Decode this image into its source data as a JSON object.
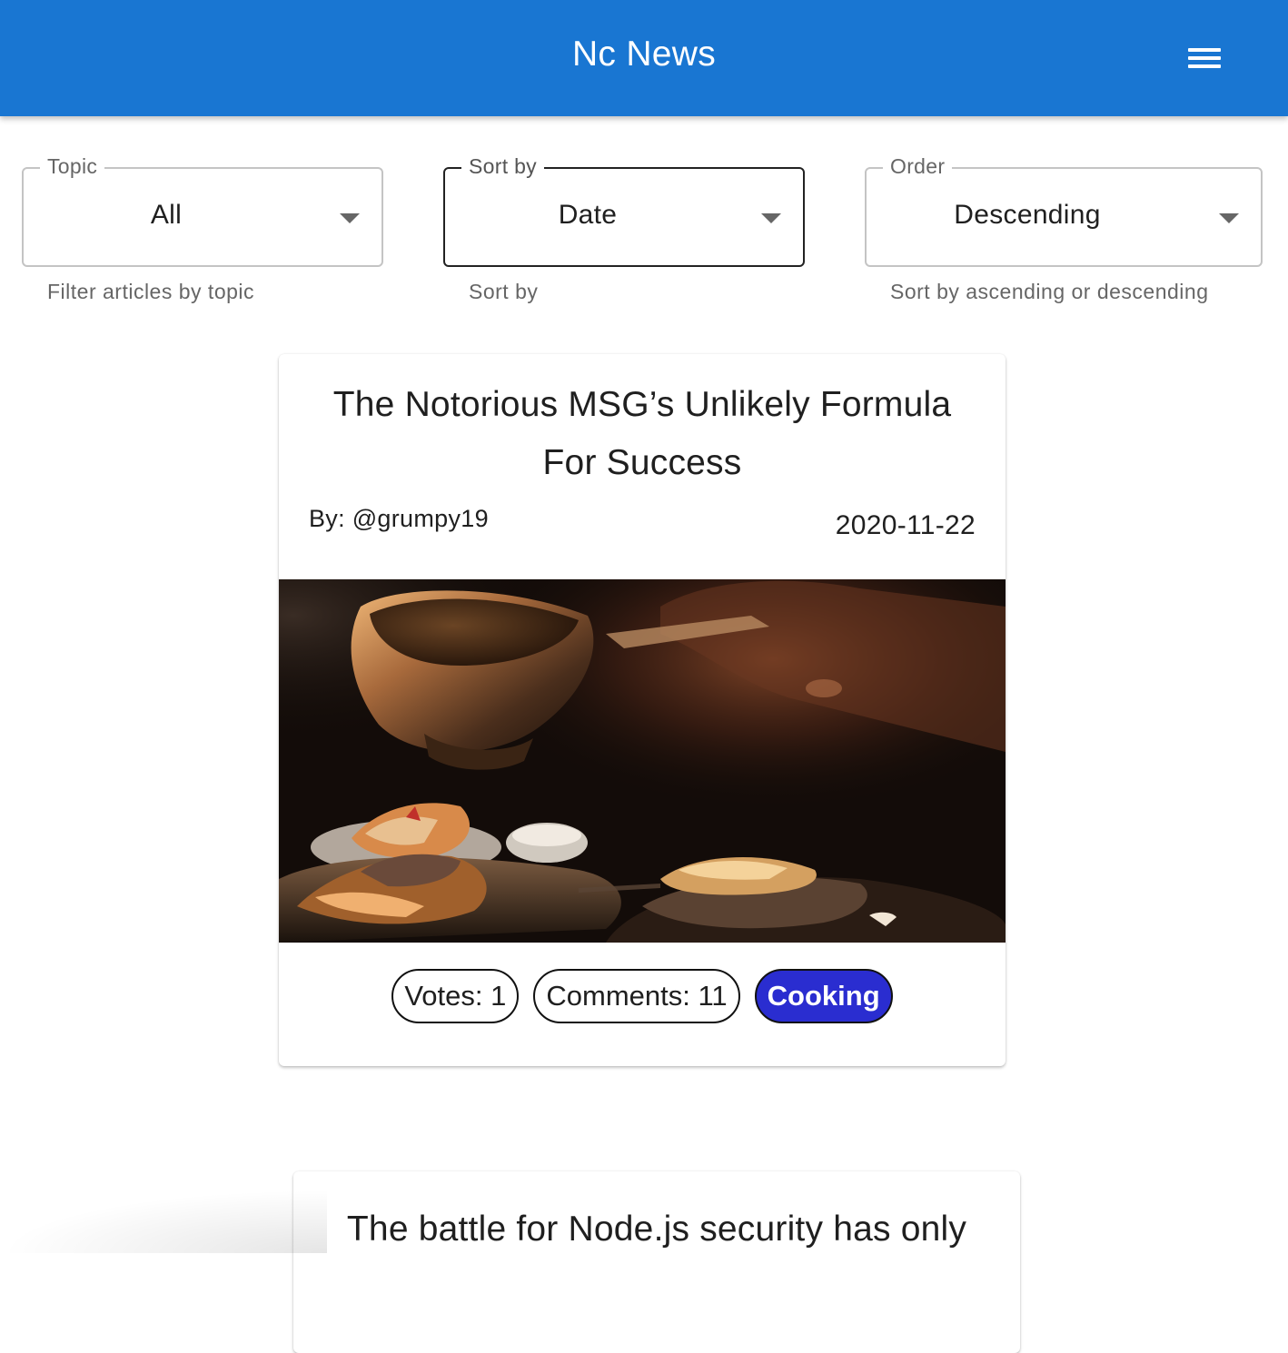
{
  "header": {
    "title": "Nc News",
    "menu_icon": "menu-icon"
  },
  "filters": {
    "topic": {
      "label": "Topic",
      "value": "All",
      "helper": "Filter articles by topic"
    },
    "sort_by": {
      "label": "Sort by",
      "value": "Date",
      "helper": "Sort by"
    },
    "order": {
      "label": "Order",
      "value": "Descending",
      "helper": "Sort by ascending or descending"
    }
  },
  "articles": [
    {
      "title": "The Notorious MSG’s Unlikely Formula For Success",
      "author": "By: @grumpy19",
      "date": "2020-11-22",
      "votes": "Votes: 1",
      "comments": "Comments: 11",
      "topic": "Cooking"
    },
    {
      "title": "The battle for Node.js security has only"
    }
  ],
  "colors": {
    "appbar": "#1976d2",
    "topic_chip": "#2a2dd0"
  }
}
